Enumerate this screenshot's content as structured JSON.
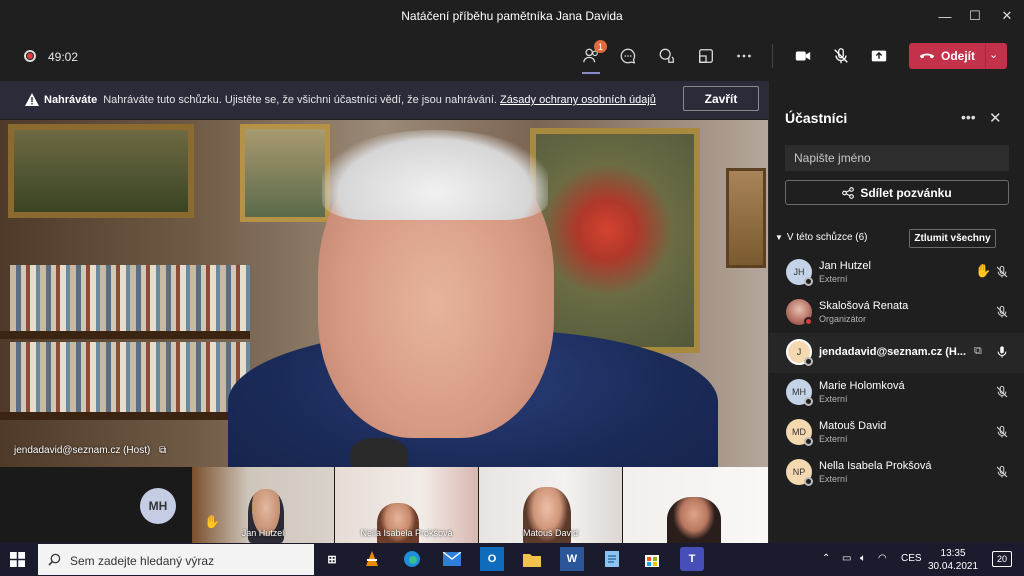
{
  "window": {
    "title": "Natáčení příběhu pamětníka Jana Davida"
  },
  "toolbar": {
    "timer": "49:02",
    "participants_badge": "1",
    "leave_label": "Odejít"
  },
  "banner": {
    "title": "Nahráváte",
    "message": "Nahráváte tuto schůzku. Ujistěte se, že všichni účastníci vědí, že jsou nahrávání.",
    "link": "Zásady ochrany osobních údajů",
    "close_label": "Zavřít"
  },
  "main_video": {
    "label": "jendadavid@seznam.cz (Host)"
  },
  "thumbnails": {
    "avatar_initials": "MH",
    "items": [
      {
        "label": "Jan Hutzel"
      },
      {
        "label": "Nella Isabela Prokšová"
      },
      {
        "label": "Matouš David"
      }
    ]
  },
  "panel": {
    "title": "Účastníci",
    "search_placeholder": "Napište jméno",
    "share_label": "Sdílet pozvánku",
    "section_label": "V této schůzce (6)",
    "mute_all_label": "Ztlumit všechny",
    "participants": [
      {
        "initials": "JH",
        "name": "Jan Hutzel",
        "role": "Externí",
        "avatar_color": "#c5d3e8"
      },
      {
        "initials": "",
        "name": "Skalošová Renata",
        "role": "Organizátor",
        "avatar_color": "#b07a6a"
      },
      {
        "initials": "J",
        "name": "jendadavid@seznam.cz (H...",
        "role": "",
        "avatar_color": "#f4d8b0"
      },
      {
        "initials": "MH",
        "name": "Marie Holomková",
        "role": "Externí",
        "avatar_color": "#c5d3e8"
      },
      {
        "initials": "MD",
        "name": "Matouš David",
        "role": "Externí",
        "avatar_color": "#f4d8b0"
      },
      {
        "initials": "NP",
        "name": "Nella Isabela Prokšová",
        "role": "Externí",
        "avatar_color": "#f4d8b0"
      }
    ]
  },
  "taskbar": {
    "search_placeholder": "Sem zadejte hledaný výraz",
    "language": "CES",
    "time": "13:35",
    "date": "30.04.2021",
    "notification_count": "20"
  }
}
